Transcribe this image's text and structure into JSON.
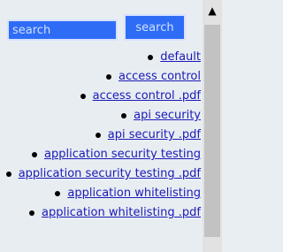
{
  "search": {
    "placeholder": "search",
    "button_label": "search"
  },
  "list": {
    "items": [
      {
        "label": "default"
      },
      {
        "label": "access control"
      },
      {
        "label": "access control .pdf"
      },
      {
        "label": "api security"
      },
      {
        "label": "api security .pdf"
      },
      {
        "label": "application security testing"
      },
      {
        "label": "application security testing .pdf"
      },
      {
        "label": "application whitelisting"
      },
      {
        "label": "application whitelisting .pdf"
      }
    ]
  },
  "scrollbar": {
    "up_arrow": "▲"
  }
}
